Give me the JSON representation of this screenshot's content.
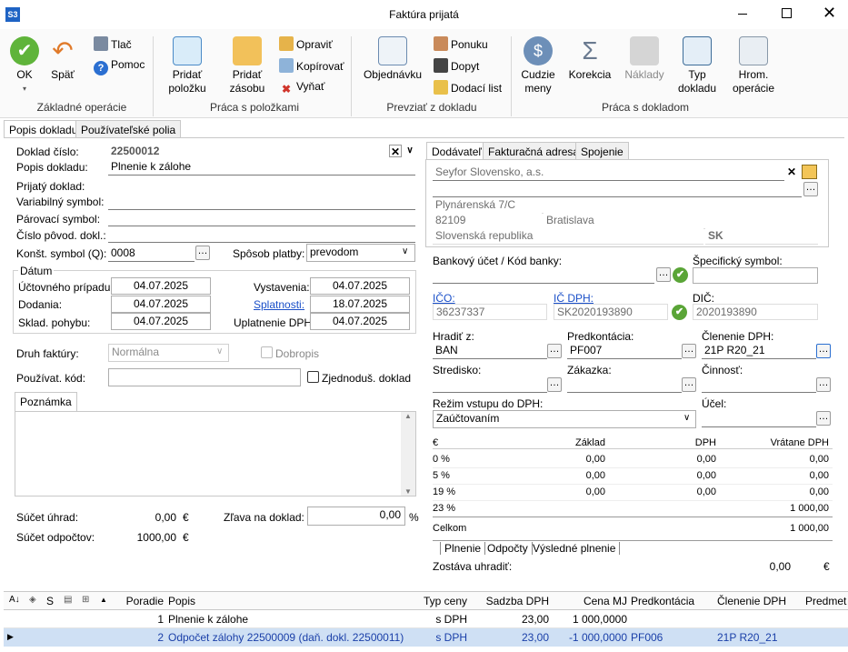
{
  "window": {
    "app_icon": "S3",
    "title": "Faktúra prijatá"
  },
  "ribbon": {
    "ok": "OK",
    "spat": "Späť",
    "tlac": "Tlač",
    "pomoc": "Pomoc",
    "grp_zakladne": "Základné operácie",
    "pridat_polozku": "Pridať položku",
    "pridat_zasobu": "Pridať zásobu",
    "opravit": "Opraviť",
    "kopirovat": "Kopírovať",
    "vynat": "Vyňať",
    "grp_praca_polozky": "Práca s položkami",
    "objednavku": "Objednávku",
    "ponuku": "Ponuku",
    "dopyt": "Dopyt",
    "dodaci_list": "Dodací list",
    "grp_prevziat": "Prevziať z dokladu",
    "cudzie_meny": "Cudzie meny",
    "korekcia": "Korekcia",
    "naklady": "Náklady",
    "typ_dokladu": "Typ dokladu",
    "hrom_operacie": "Hrom. operácie",
    "grp_praca_doklad": "Práca s dokladom"
  },
  "tabs": {
    "popis": "Popis dokladu",
    "polia": "Používateľské polia"
  },
  "left": {
    "doklad_cislo_lbl": "Doklad číslo:",
    "doklad_cislo": "22500012",
    "popis_lbl": "Popis dokladu:",
    "popis": "Plnenie k zálohe",
    "prijaty_lbl": "Prijatý doklad:",
    "variabilny_lbl": "Variabilný symbol:",
    "parovaci_lbl": "Párovací symbol:",
    "cislo_povod_lbl": "Číslo pôvod. dokl.:",
    "konst_lbl": "Konšt. symbol (Q):",
    "konst": "0008",
    "sposob_lbl": "Spôsob platby:",
    "sposob": "prevodom",
    "datum_lbl": "Dátum",
    "uctovneho_lbl": "Účtovného prípadu:",
    "uctovneho": "04.07.2025",
    "dodania_lbl": "Dodania:",
    "dodania": "04.07.2025",
    "sklad_lbl": "Sklad. pohybu:",
    "sklad": "04.07.2025",
    "vystavenia_lbl": "Vystavenia:",
    "vystavenia": "04.07.2025",
    "splatnosti_lbl": "Splatnosti:",
    "splatnosti": "18.07.2025",
    "uplatnenie_lbl": "Uplatnenie DPH:",
    "uplatnenie": "04.07.2025",
    "druh_lbl": "Druh faktúry:",
    "druh": "Normálna",
    "dobropis": "Dobropis",
    "pouzivat_lbl": "Používat. kód:",
    "zjednodus": "Zjednoduš. doklad",
    "poznamka": "Poznámka",
    "sucet_uhrad_lbl": "Súčet úhrad:",
    "sucet_uhrad": "0,00",
    "sucet_odpoctov_lbl": "Súčet odpočtov:",
    "sucet_odpoctov": "1000,00",
    "eur": "€",
    "zlava_lbl": "Zľava na doklad:",
    "zlava": "0,00",
    "pct": "%"
  },
  "right": {
    "tab_dodavatel": "Dodávateľ",
    "tab_fakturacna": "Fakturačná adresa",
    "tab_spojenie": "Spojenie",
    "firma": "Seyfor Slovensko, a.s.",
    "ulica": "Plynárenská 7/C",
    "psc": "82109",
    "mesto": "Bratislava",
    "stat": "Slovenská republika",
    "stat_kod": "SK",
    "banka_lbl": "Bankový účet / Kód banky:",
    "spec_lbl": "Špecifický symbol:",
    "ico_lbl": "IČO:",
    "ico": "36237337",
    "icdph_lbl": "IČ DPH:",
    "icdph": "SK2020193890",
    "dic_lbl": "DIČ:",
    "dic": "2020193890",
    "hradit_lbl": "Hradiť z:",
    "hradit": "BAN",
    "predkont_lbl": "Predkontácia:",
    "predkont": "PF007",
    "clenenie_lbl": "Členenie DPH:",
    "clenenie": "21P R20_21",
    "stredisko_lbl": "Stredisko:",
    "zakazka_lbl": "Zákazka:",
    "cinnost_lbl": "Činnosť:",
    "rezim_lbl": "Režim vstupu do DPH:",
    "rezim": "Zaúčtovaním",
    "ucel_lbl": "Účel:"
  },
  "summary": {
    "headers": [
      "€",
      "Základ",
      "DPH",
      "Vrátane DPH"
    ],
    "rows": [
      [
        "0 %",
        "0,00",
        "0,00",
        "0,00"
      ],
      [
        "5 %",
        "0,00",
        "0,00",
        "0,00"
      ],
      [
        "19 %",
        "0,00",
        "0,00",
        "0,00"
      ],
      [
        "23 %",
        "",
        "",
        "1 000,00"
      ]
    ],
    "celkom_lbl": "Celkom",
    "celkom": "1 000,00",
    "tab_plnenie": "Plnenie",
    "tab_odpocty": "Odpočty",
    "tab_vysledne": "Výsledné plnenie",
    "zostava_lbl": "Zostáva uhradiť:",
    "zostava": "0,00",
    "zostava_cur": "€"
  },
  "grid": {
    "headers": {
      "s": "S",
      "poradie": "Poradie",
      "popis": "Popis",
      "typ": "Typ ceny",
      "sadzba": "Sadzba DPH",
      "cena": "Cena MJ",
      "predkont": "Predkontácia",
      "clenenie": "Členenie DPH",
      "predmet": "Predmet"
    },
    "rows": [
      {
        "poradie": "1",
        "popis": "Plnenie k zálohe",
        "typ": "s DPH",
        "sadzba": "23,00",
        "cena": "1 000,0000",
        "predkont": "",
        "clenenie": ""
      },
      {
        "poradie": "2",
        "popis": "Odpočet zálohy 22500009 (daň. dokl. 22500011)",
        "typ": "s DPH",
        "sadzba": "23,00",
        "cena": "-1 000,0000",
        "predkont": "PF006",
        "clenenie": "21P R20_21"
      }
    ]
  }
}
